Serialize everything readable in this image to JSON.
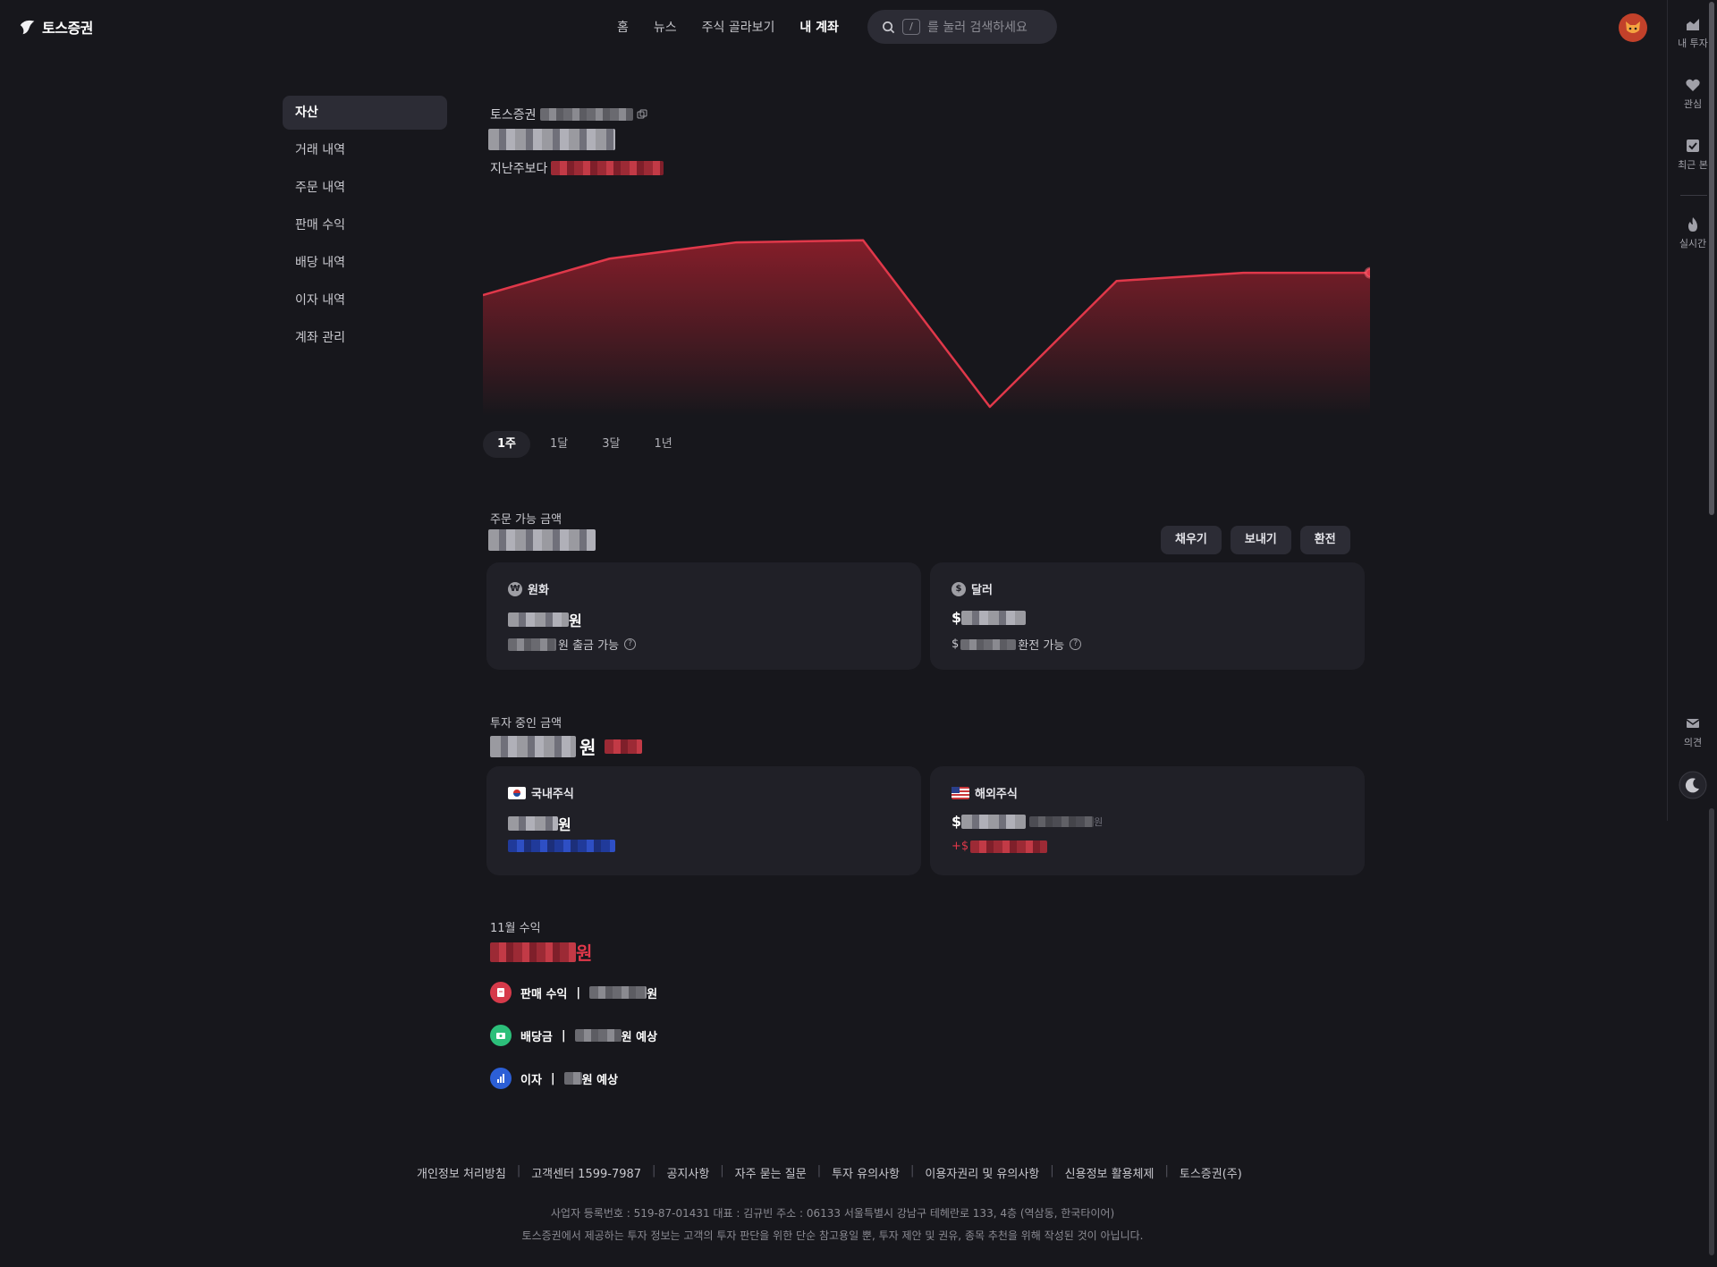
{
  "header": {
    "logo_text": "토스증권",
    "nav": [
      "홈",
      "뉴스",
      "주식 골라보기",
      "내 계좌"
    ],
    "search_key": "/",
    "search_placeholder": "를 눌러 검색하세요"
  },
  "rail": {
    "items": [
      {
        "label": "내 투자",
        "icon": "chart-icon"
      },
      {
        "label": "관심",
        "icon": "heart-icon"
      },
      {
        "label": "최근 본",
        "icon": "check-icon"
      },
      {
        "label": "실시간",
        "icon": "fire-icon"
      },
      {
        "label": "의견",
        "icon": "mail-icon"
      }
    ]
  },
  "sidebar": {
    "items": [
      "자산",
      "거래 내역",
      "주문 내역",
      "판매 수익",
      "배당 내역",
      "이자 내역",
      "계좌 관리"
    ]
  },
  "account": {
    "broker": "토스증권",
    "compare_label": "지난주보다"
  },
  "chart_data": {
    "type": "area",
    "series": [
      {
        "values": [
          0.55,
          0.73,
          0.81,
          0.82,
          0.0,
          0.62,
          0.66,
          0.66
        ]
      }
    ],
    "line_color": "#e0384a",
    "note_y": "relative values; axis and amounts hidden"
  },
  "periods": [
    "1주",
    "1달",
    "3달",
    "1년"
  ],
  "orderable": {
    "label": "주문 가능 금액",
    "actions": [
      "채우기",
      "보내기",
      "환전"
    ],
    "krw": {
      "title": "원화",
      "coin": "₩",
      "unit": "원",
      "sub": "원 출금 가능"
    },
    "usd": {
      "title": "달러",
      "coin": "$",
      "prefix": "$",
      "sub_prefix": "$",
      "sub": " 환전 가능"
    }
  },
  "investing": {
    "label": "투자 중인 금액",
    "unit": "원",
    "domestic": {
      "title": "국내주식",
      "unit": "원"
    },
    "foreign": {
      "title": "해외주식",
      "prefix": "$",
      "krw_unit": "원",
      "gain_prefix": "+$"
    }
  },
  "monthly": {
    "label": "11월 수익",
    "unit": "원",
    "rows": [
      {
        "label": "판매 수익",
        "sep": "|",
        "suffix": "원"
      },
      {
        "label": "배당금",
        "sep": "|",
        "suffix": "원 예상"
      },
      {
        "label": "이자",
        "sep": "|",
        "suffix": "원 예상"
      }
    ]
  },
  "footer": {
    "links": [
      "개인정보 처리방침",
      "고객센터 1599-7987",
      "공지사항",
      "자주 묻는 질문",
      "투자 유의사항",
      "이용자권리 및 유의사항",
      "신용정보 활용체제",
      "토스증권(주)"
    ],
    "info1": "사업자 등록번호 : 519-87-01431    대표 : 김규빈    주소 : 06133 서울특별시 강남구 테헤란로 133, 4층 (역삼동, 한국타이어)",
    "info2": "토스증권에서 제공하는 투자 정보는 고객의 투자 판단을 위한 단순 참고용일 뿐, 투자 제안 및 권유, 종목 추천을 위해 작성된 것이 아닙니다."
  }
}
